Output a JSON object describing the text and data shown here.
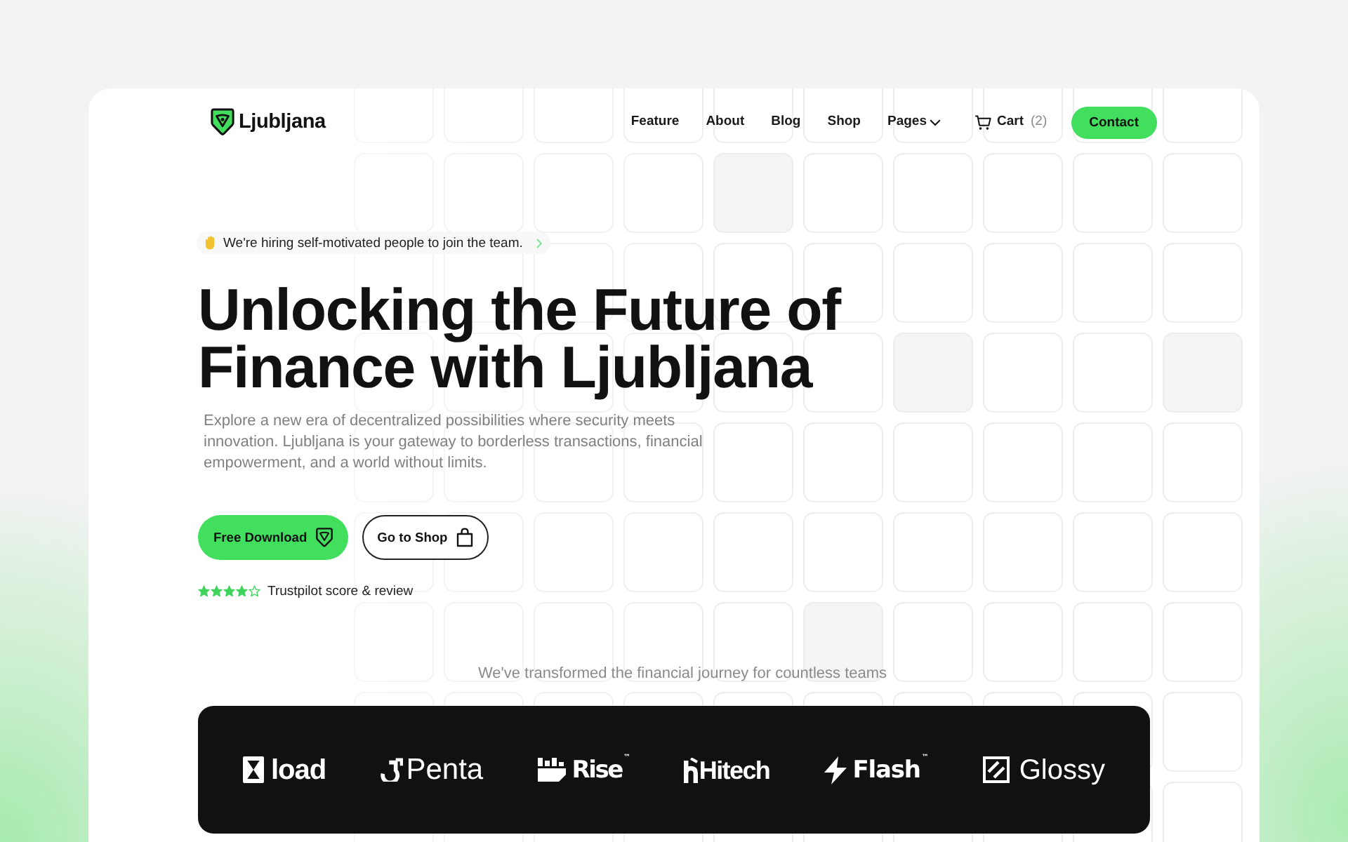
{
  "nav": {
    "brand": "Ljubljana",
    "links": [
      {
        "label": "Feature",
        "kind": "link"
      },
      {
        "label": "About",
        "kind": "link"
      },
      {
        "label": "Blog",
        "kind": "link"
      },
      {
        "label": "Shop",
        "kind": "link"
      },
      {
        "label": "Pages",
        "kind": "dropdown"
      }
    ],
    "cart": {
      "label": "Cart",
      "count": "(2)"
    },
    "cta": "Contact"
  },
  "hero": {
    "badge": "We're hiring self-motivated people to join the team.",
    "title": "Unlocking the Future of Finance with Ljubljana",
    "description": "Explore a new era of decentralized possibilities where security meets innovation. Ljubljana is your gateway to borderless transactions, financial empowerment, and a world without limits.",
    "buttons": [
      {
        "label": "Free Download",
        "kind": "primary"
      },
      {
        "label": "Go to Shop",
        "kind": "secondary"
      }
    ],
    "rating": {
      "stars": 4,
      "text": "Trustpilot score & review"
    }
  },
  "clients": {
    "caption": "We've transformed the financial journey for countless teams",
    "logos": [
      {
        "name": "load"
      },
      {
        "name": "Penta"
      },
      {
        "name": "Rise$^{™}$"
      },
      {
        "name": "Hitech"
      },
      {
        "name": "Flash$^{™}$"
      },
      {
        "name": "Glossy"
      }
    ]
  }
}
